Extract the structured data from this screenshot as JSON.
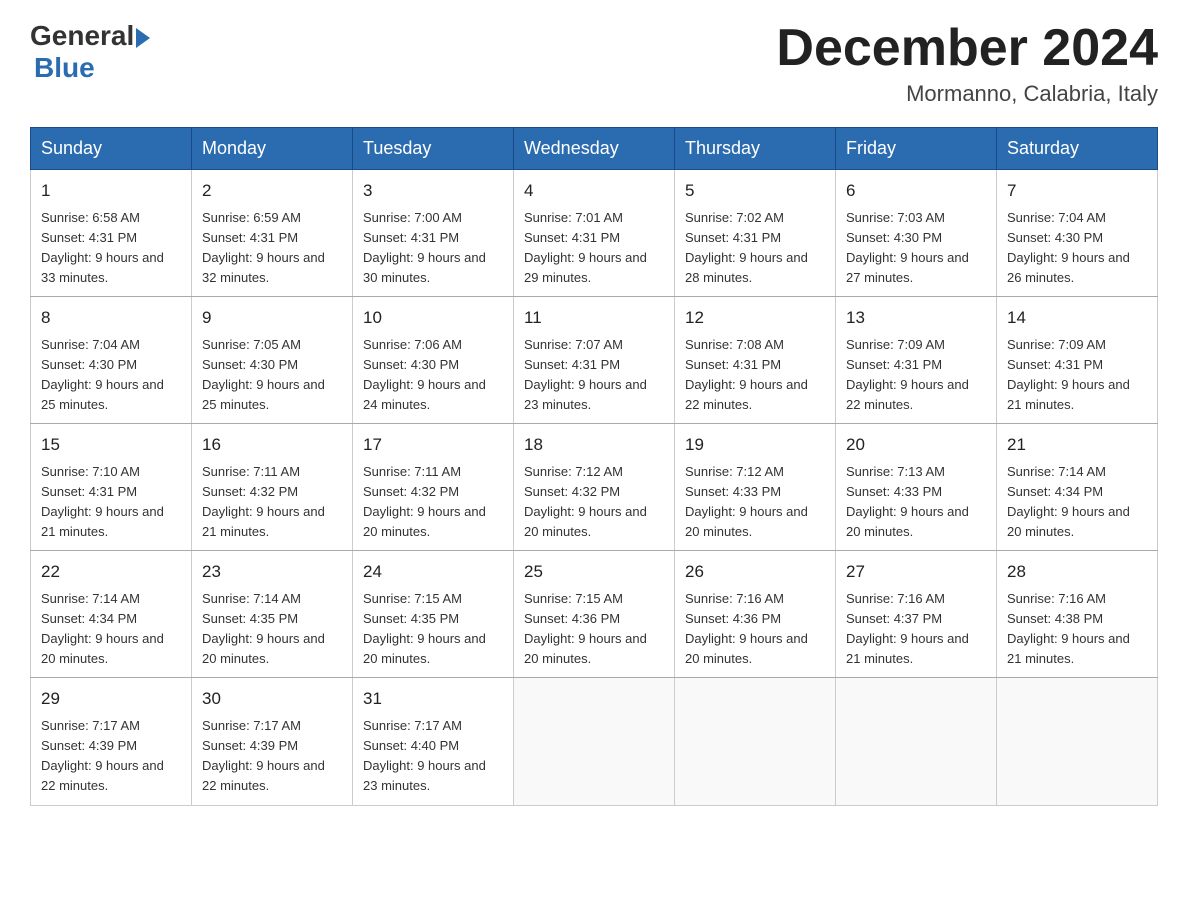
{
  "header": {
    "logo_general": "General",
    "logo_blue": "Blue",
    "month_title": "December 2024",
    "location": "Mormanno, Calabria, Italy"
  },
  "days_of_week": [
    "Sunday",
    "Monday",
    "Tuesday",
    "Wednesday",
    "Thursday",
    "Friday",
    "Saturday"
  ],
  "weeks": [
    [
      {
        "day": "1",
        "sunrise": "6:58 AM",
        "sunset": "4:31 PM",
        "daylight": "9 hours and 33 minutes."
      },
      {
        "day": "2",
        "sunrise": "6:59 AM",
        "sunset": "4:31 PM",
        "daylight": "9 hours and 32 minutes."
      },
      {
        "day": "3",
        "sunrise": "7:00 AM",
        "sunset": "4:31 PM",
        "daylight": "9 hours and 30 minutes."
      },
      {
        "day": "4",
        "sunrise": "7:01 AM",
        "sunset": "4:31 PM",
        "daylight": "9 hours and 29 minutes."
      },
      {
        "day": "5",
        "sunrise": "7:02 AM",
        "sunset": "4:31 PM",
        "daylight": "9 hours and 28 minutes."
      },
      {
        "day": "6",
        "sunrise": "7:03 AM",
        "sunset": "4:30 PM",
        "daylight": "9 hours and 27 minutes."
      },
      {
        "day": "7",
        "sunrise": "7:04 AM",
        "sunset": "4:30 PM",
        "daylight": "9 hours and 26 minutes."
      }
    ],
    [
      {
        "day": "8",
        "sunrise": "7:04 AM",
        "sunset": "4:30 PM",
        "daylight": "9 hours and 25 minutes."
      },
      {
        "day": "9",
        "sunrise": "7:05 AM",
        "sunset": "4:30 PM",
        "daylight": "9 hours and 25 minutes."
      },
      {
        "day": "10",
        "sunrise": "7:06 AM",
        "sunset": "4:30 PM",
        "daylight": "9 hours and 24 minutes."
      },
      {
        "day": "11",
        "sunrise": "7:07 AM",
        "sunset": "4:31 PM",
        "daylight": "9 hours and 23 minutes."
      },
      {
        "day": "12",
        "sunrise": "7:08 AM",
        "sunset": "4:31 PM",
        "daylight": "9 hours and 22 minutes."
      },
      {
        "day": "13",
        "sunrise": "7:09 AM",
        "sunset": "4:31 PM",
        "daylight": "9 hours and 22 minutes."
      },
      {
        "day": "14",
        "sunrise": "7:09 AM",
        "sunset": "4:31 PM",
        "daylight": "9 hours and 21 minutes."
      }
    ],
    [
      {
        "day": "15",
        "sunrise": "7:10 AM",
        "sunset": "4:31 PM",
        "daylight": "9 hours and 21 minutes."
      },
      {
        "day": "16",
        "sunrise": "7:11 AM",
        "sunset": "4:32 PM",
        "daylight": "9 hours and 21 minutes."
      },
      {
        "day": "17",
        "sunrise": "7:11 AM",
        "sunset": "4:32 PM",
        "daylight": "9 hours and 20 minutes."
      },
      {
        "day": "18",
        "sunrise": "7:12 AM",
        "sunset": "4:32 PM",
        "daylight": "9 hours and 20 minutes."
      },
      {
        "day": "19",
        "sunrise": "7:12 AM",
        "sunset": "4:33 PM",
        "daylight": "9 hours and 20 minutes."
      },
      {
        "day": "20",
        "sunrise": "7:13 AM",
        "sunset": "4:33 PM",
        "daylight": "9 hours and 20 minutes."
      },
      {
        "day": "21",
        "sunrise": "7:14 AM",
        "sunset": "4:34 PM",
        "daylight": "9 hours and 20 minutes."
      }
    ],
    [
      {
        "day": "22",
        "sunrise": "7:14 AM",
        "sunset": "4:34 PM",
        "daylight": "9 hours and 20 minutes."
      },
      {
        "day": "23",
        "sunrise": "7:14 AM",
        "sunset": "4:35 PM",
        "daylight": "9 hours and 20 minutes."
      },
      {
        "day": "24",
        "sunrise": "7:15 AM",
        "sunset": "4:35 PM",
        "daylight": "9 hours and 20 minutes."
      },
      {
        "day": "25",
        "sunrise": "7:15 AM",
        "sunset": "4:36 PM",
        "daylight": "9 hours and 20 minutes."
      },
      {
        "day": "26",
        "sunrise": "7:16 AM",
        "sunset": "4:36 PM",
        "daylight": "9 hours and 20 minutes."
      },
      {
        "day": "27",
        "sunrise": "7:16 AM",
        "sunset": "4:37 PM",
        "daylight": "9 hours and 21 minutes."
      },
      {
        "day": "28",
        "sunrise": "7:16 AM",
        "sunset": "4:38 PM",
        "daylight": "9 hours and 21 minutes."
      }
    ],
    [
      {
        "day": "29",
        "sunrise": "7:17 AM",
        "sunset": "4:39 PM",
        "daylight": "9 hours and 22 minutes."
      },
      {
        "day": "30",
        "sunrise": "7:17 AM",
        "sunset": "4:39 PM",
        "daylight": "9 hours and 22 minutes."
      },
      {
        "day": "31",
        "sunrise": "7:17 AM",
        "sunset": "4:40 PM",
        "daylight": "9 hours and 23 minutes."
      },
      null,
      null,
      null,
      null
    ]
  ]
}
